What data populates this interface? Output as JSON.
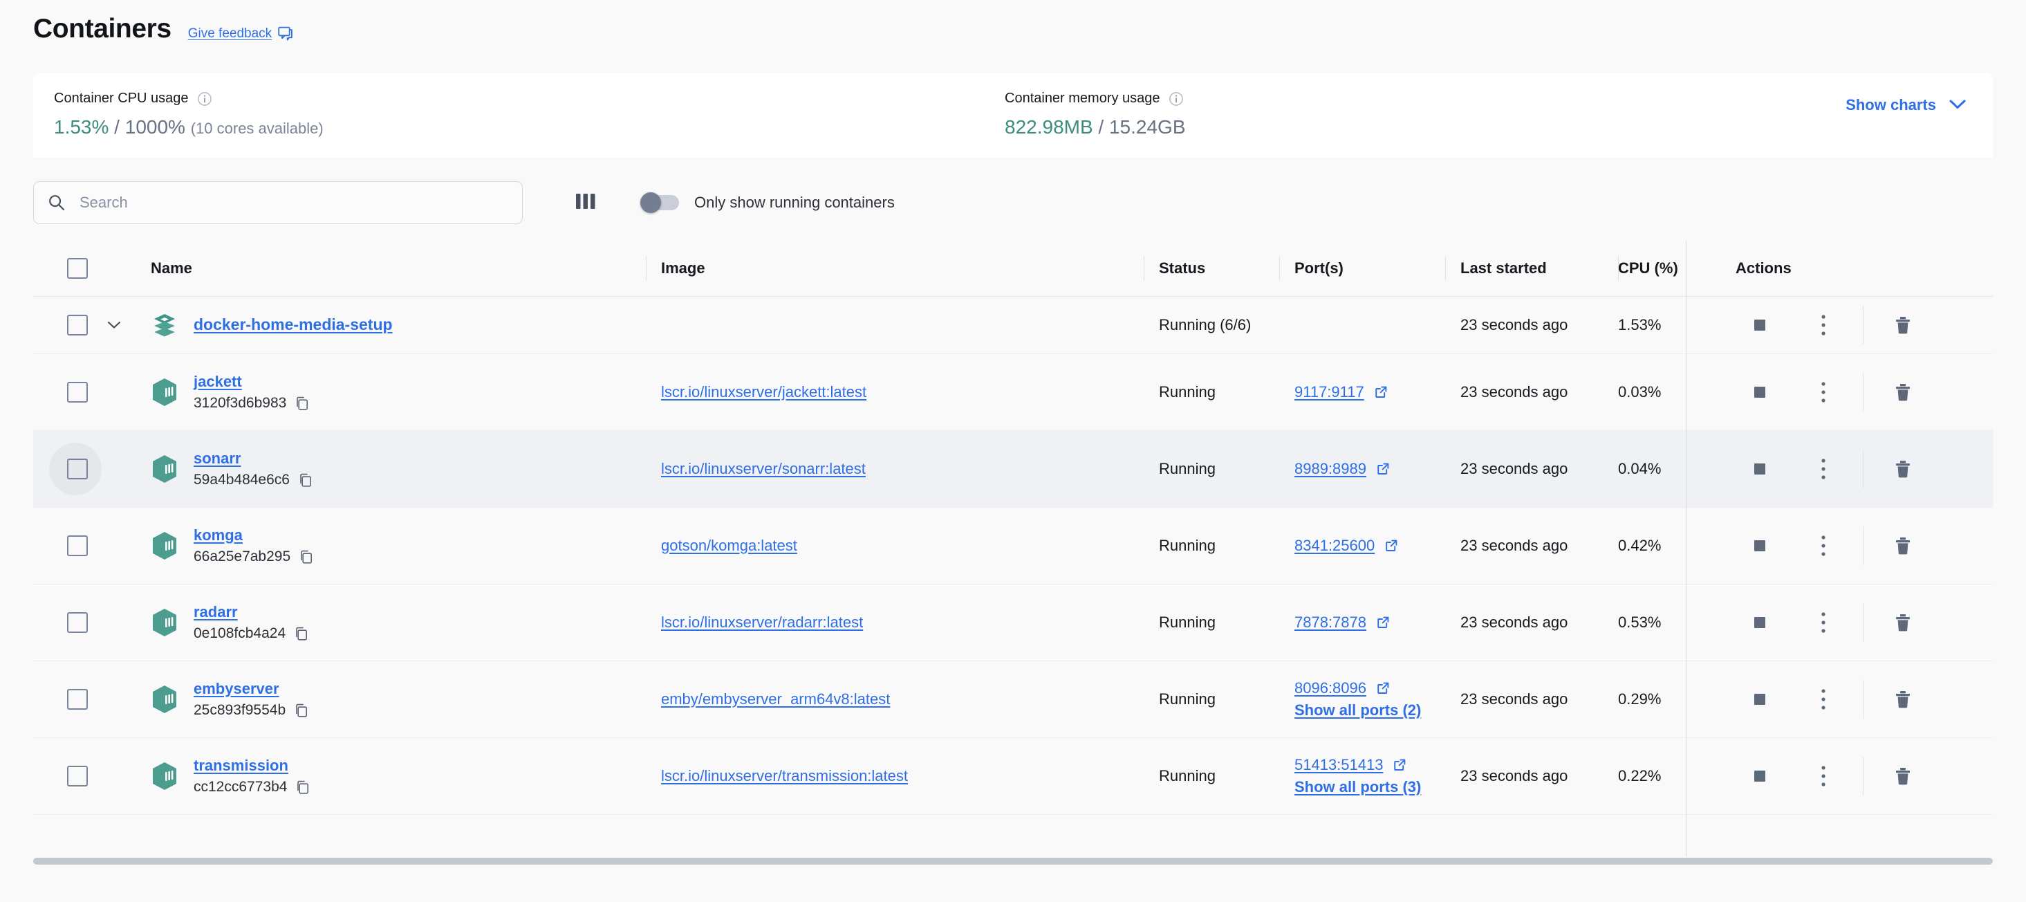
{
  "header": {
    "title": "Containers",
    "feedback_label": "Give feedback",
    "feedback_icon": "feedback-chat-icon"
  },
  "stats": {
    "cpu": {
      "label": "Container CPU usage",
      "info_icon": "info-icon",
      "used": "1.53%",
      "separator": " / ",
      "total": "1000%",
      "note": "(10 cores available)"
    },
    "memory": {
      "label": "Container memory usage",
      "info_icon": "info-icon",
      "used": "822.98MB",
      "separator": " / ",
      "total": "15.24GB",
      "note": ""
    },
    "show_charts_label": "Show charts",
    "show_charts_icon": "chevron-down-icon"
  },
  "toolbar": {
    "search_placeholder": "Search",
    "search_value": "",
    "search_icon": "search-icon",
    "columns_icon": "columns-icon",
    "toggle_label": "Only show running containers",
    "toggle_on": false
  },
  "table": {
    "columns": {
      "name": "Name",
      "image": "Image",
      "status": "Status",
      "ports": "Port(s)",
      "last_started": "Last started",
      "cpu": "CPU (%)",
      "actions": "Actions"
    },
    "rows": [
      {
        "kind": "stack",
        "icon": "stack-icon",
        "name": "docker-home-media-setup",
        "container_id": "",
        "image": "",
        "status": "Running (6/6)",
        "port": "",
        "more_ports": "",
        "last_started": "23 seconds ago",
        "cpu": "1.53%",
        "hovered": false
      },
      {
        "kind": "container",
        "icon": "container-icon",
        "name": "jackett",
        "container_id": "3120f3d6b983",
        "image": "lscr.io/linuxserver/jackett:latest",
        "status": "Running",
        "port": "9117:9117",
        "more_ports": "",
        "last_started": "23 seconds ago",
        "cpu": "0.03%",
        "hovered": false
      },
      {
        "kind": "container",
        "icon": "container-icon",
        "name": "sonarr",
        "container_id": "59a4b484e6c6",
        "image": "lscr.io/linuxserver/sonarr:latest",
        "status": "Running",
        "port": "8989:8989",
        "more_ports": "",
        "last_started": "23 seconds ago",
        "cpu": "0.04%",
        "hovered": true
      },
      {
        "kind": "container",
        "icon": "container-icon",
        "name": "komga",
        "container_id": "66a25e7ab295",
        "image": "gotson/komga:latest",
        "status": "Running",
        "port": "8341:25600",
        "more_ports": "",
        "last_started": "23 seconds ago",
        "cpu": "0.42%",
        "hovered": false
      },
      {
        "kind": "container",
        "icon": "container-icon",
        "name": "radarr",
        "container_id": "0e108fcb4a24",
        "image": "lscr.io/linuxserver/radarr:latest",
        "status": "Running",
        "port": "7878:7878",
        "more_ports": "",
        "last_started": "23 seconds ago",
        "cpu": "0.53%",
        "hovered": false
      },
      {
        "kind": "container",
        "icon": "container-icon",
        "name": "embyserver",
        "container_id": "25c893f9554b",
        "image": "emby/embyserver_arm64v8:latest",
        "status": "Running",
        "port": "8096:8096",
        "more_ports": "Show all ports (2)",
        "last_started": "23 seconds ago",
        "cpu": "0.29%",
        "hovered": false
      },
      {
        "kind": "container",
        "icon": "container-icon",
        "name": "transmission",
        "container_id": "cc12cc6773b4",
        "image": "lscr.io/linuxserver/transmission:latest",
        "status": "Running",
        "port": "51413:51413",
        "more_ports": "Show all ports (3)",
        "last_started": "23 seconds ago",
        "cpu": "0.22%",
        "hovered": false
      }
    ],
    "action_icons": {
      "stop": "stop-icon",
      "menu": "kebab-menu-icon",
      "delete": "trash-icon"
    }
  },
  "colors": {
    "link": "#2f6fe4",
    "accent_teal": "#3d8c7e",
    "page_bg": "#f9f9fa",
    "card_bg": "#ffffff",
    "row_hover": "#eff1f4"
  }
}
